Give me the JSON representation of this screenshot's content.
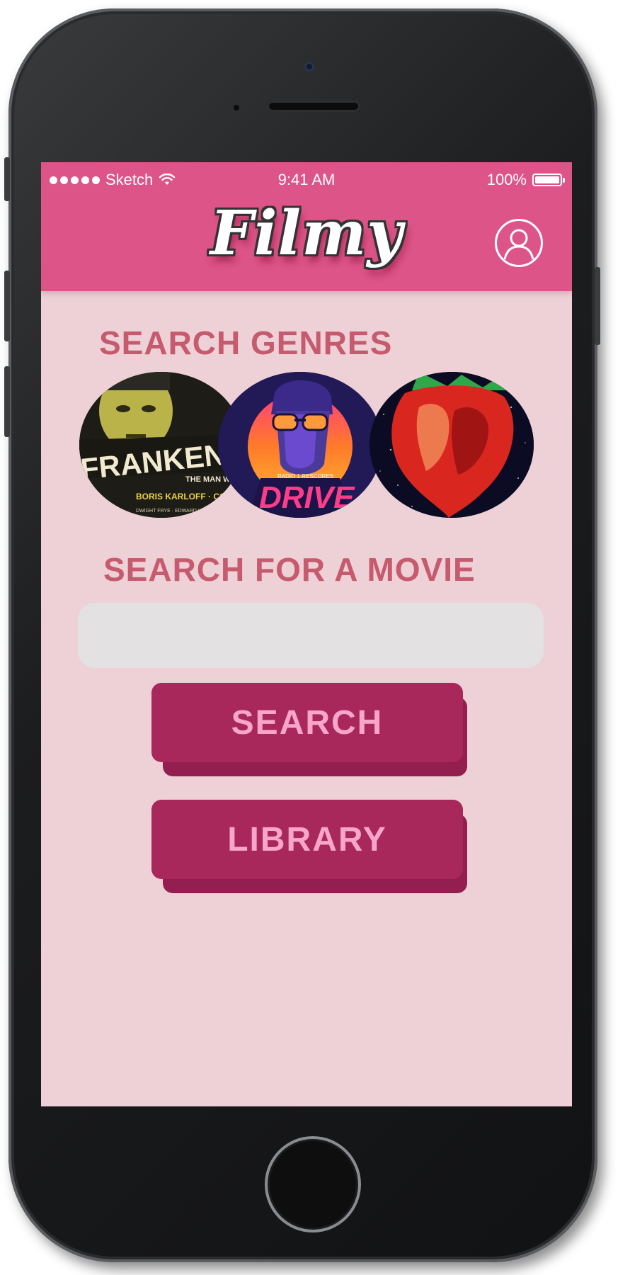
{
  "status_bar": {
    "carrier": "Sketch",
    "time": "9:41 AM",
    "battery": "100%",
    "battery_level": 1.0,
    "signal_icon": "signal-dots-icon",
    "wifi_icon": "wifi-icon"
  },
  "header": {
    "logo": "Filmy",
    "profile_icon": "user-profile-icon"
  },
  "genres": {
    "title": "SEARCH GENRES",
    "items": [
      {
        "poster_title": "FRANKENSTEIN",
        "poster_tagline": "THE MAN WHO MADE A MONSTER",
        "poster_credits": "BORIS KARLOFF · COLIN CLIVE\nMAE CLARKE · JOHN BOLES",
        "poster_small": "DWIGHT FRYE · EDWARD VAN SLOAN"
      },
      {
        "poster_title": "DRIVE",
        "poster_tagline": "RADIO 1 RESCORES"
      },
      {
        "poster_title": ""
      }
    ]
  },
  "search": {
    "title": "SEARCH FOR A MOVIE",
    "value": "",
    "placeholder": "",
    "search_button": "SEARCH",
    "library_button": "LIBRARY"
  },
  "colors": {
    "header": "#dd5488",
    "background": "#eed1d6",
    "section_title": "#c65a6e",
    "button": "#a8285c",
    "button_text": "#f7a6c8",
    "input": "#e3e1e2"
  }
}
